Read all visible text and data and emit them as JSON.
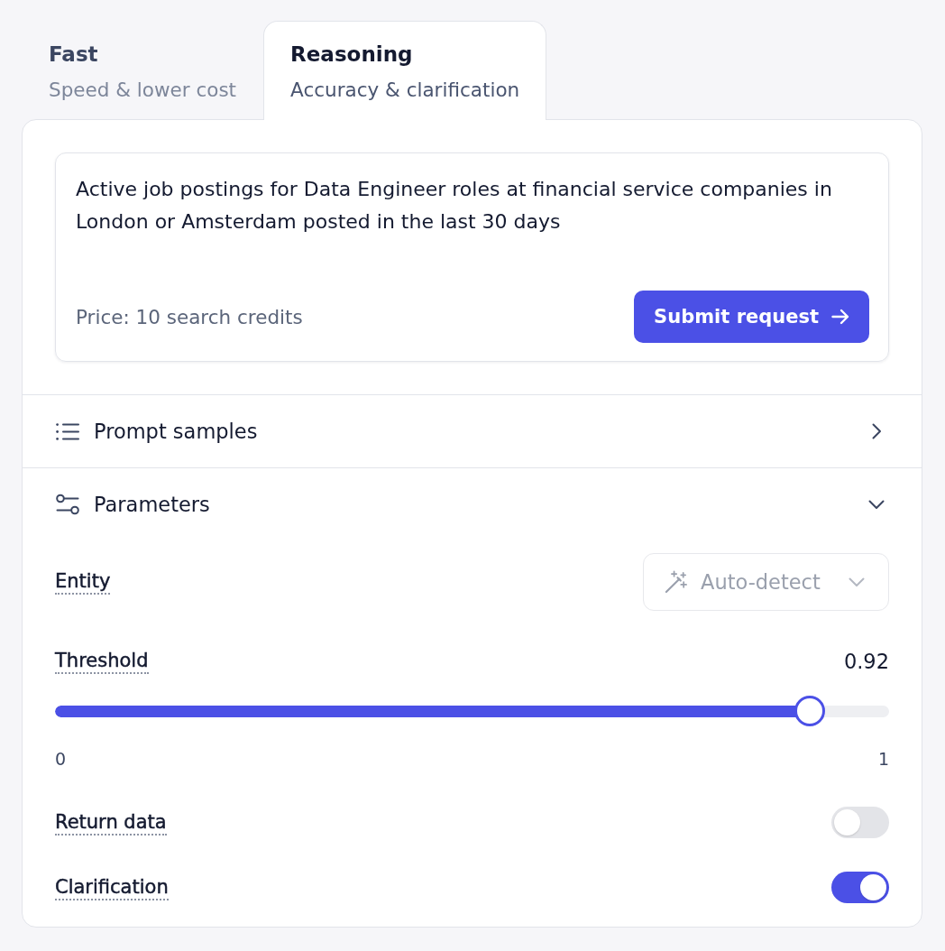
{
  "tabs": [
    {
      "title": "Fast",
      "subtitle": "Speed & lower cost",
      "selected": false
    },
    {
      "title": "Reasoning",
      "subtitle": "Accuracy & clarification",
      "selected": true
    }
  ],
  "prompt": {
    "value": "Active job postings for Data Engineer roles at financial service companies in London or Amsterdam posted in the last 30 days",
    "price": "Price: 10 search credits",
    "submit_button": "Submit request"
  },
  "sections": [
    {
      "kind": "list",
      "label": "Prompt samples",
      "expanded": false
    },
    {
      "kind": "sliders",
      "label": "Parameters",
      "expanded": true,
      "parameters": [
        {
          "kind": "select",
          "label": "Entity",
          "placeholder": "Auto-detect"
        },
        {
          "kind": "slider",
          "label": "Threshold",
          "reading": "0.92",
          "level": 0.92,
          "min_label": "0",
          "max_label": "1"
        },
        {
          "kind": "toggle",
          "label": "Return data",
          "on": false
        },
        {
          "kind": "toggle",
          "label": "Clarification",
          "on": true
        }
      ]
    }
  ]
}
